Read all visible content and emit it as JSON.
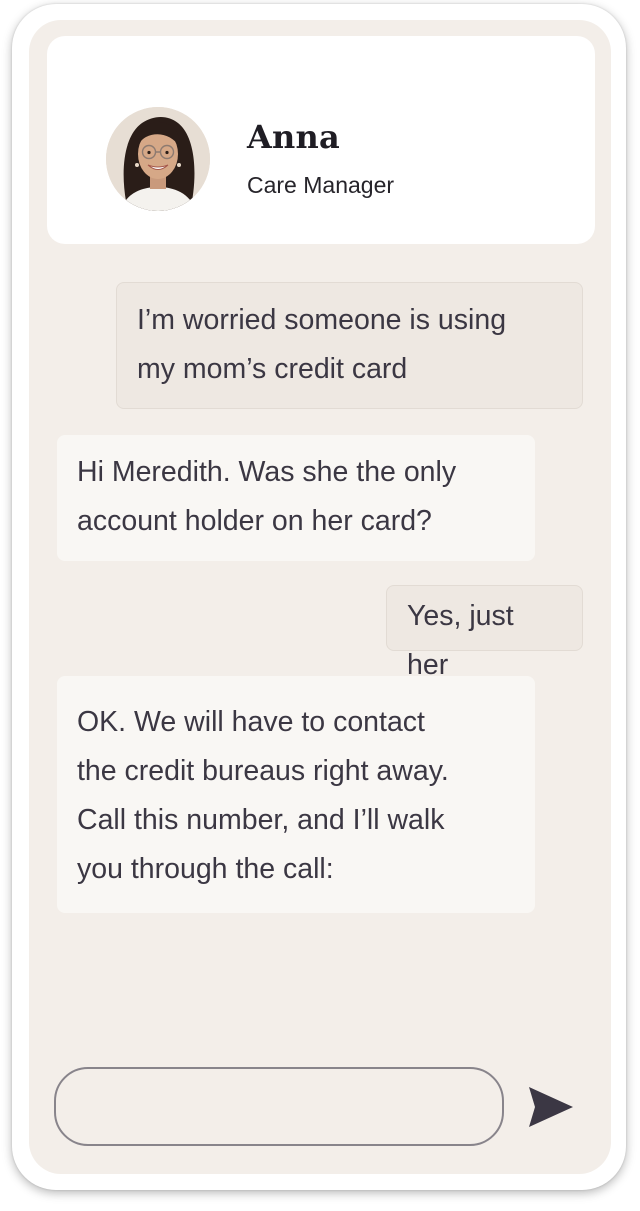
{
  "contact": {
    "name": "Anna",
    "role": "Care Manager"
  },
  "messages": [
    {
      "sender": "user",
      "text": "I’m worried someone is using\nmy mom’s credit card"
    },
    {
      "sender": "contact",
      "text": "Hi Meredith. Was she the only\naccount holder on her card?"
    },
    {
      "sender": "user",
      "text": "Yes, just her"
    },
    {
      "sender": "contact",
      "text": "OK. We will have to contact\nthe credit bureaus right away.\nCall this number, and I’ll walk\nyou through the call:"
    }
  ],
  "composer": {
    "value": "",
    "placeholder": ""
  },
  "icons": {
    "send": "send-arrow-icon",
    "avatar": "avatar-photo"
  },
  "colors": {
    "screen_bg": "#f3eee9",
    "outgoing_bubble": "#eee8e2",
    "incoming_bubble": "#f9f7f4",
    "text": "#3b3743",
    "send_icon": "#3b3744"
  }
}
